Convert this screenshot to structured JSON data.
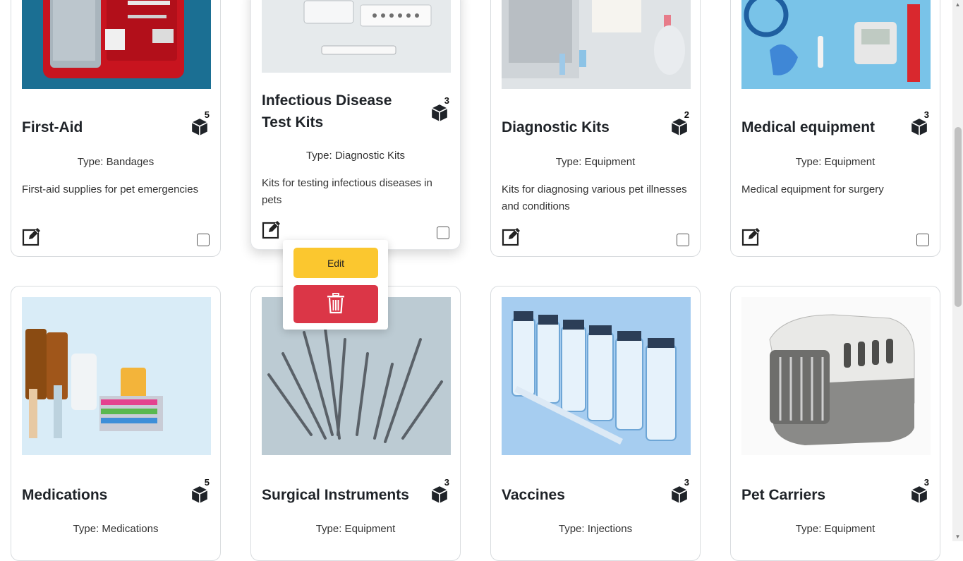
{
  "colors": {
    "edit_button": "#fbc72f",
    "delete_button": "#db3647"
  },
  "cards": [
    {
      "title": "First-Aid",
      "quantity": "5",
      "type": "Type: Bandages",
      "description": "First-aid supplies for pet emergencies",
      "image": "first-aid-kit-image"
    },
    {
      "title": "Infectious Disease Test Kits",
      "quantity": "3",
      "type": "Type: Diagnostic Kits",
      "description": "Kits for testing infectious diseases in pets",
      "image": "test-kit-image"
    },
    {
      "title": "Diagnostic Kits",
      "quantity": "2",
      "type": "Type: Equipment",
      "description": "Kits for diagnosing various pet illnesses and conditions",
      "image": "diagnostic-kit-image"
    },
    {
      "title": "Medical equipment",
      "quantity": "3",
      "type": "Type: Equipment",
      "description": "Medical equipment for surgery",
      "image": "medical-equipment-image"
    },
    {
      "title": "Medications",
      "quantity": "5",
      "type": "Type: Medications",
      "description": "",
      "image": "medications-image"
    },
    {
      "title": "Surgical Instruments",
      "quantity": "3",
      "type": "Type: Equipment",
      "description": "",
      "image": "surgical-instruments-image"
    },
    {
      "title": "Vaccines",
      "quantity": "3",
      "type": "Type: Injections",
      "description": "",
      "image": "vaccines-image"
    },
    {
      "title": "Pet Carriers",
      "quantity": "3",
      "type": "Type: Equipment",
      "description": "",
      "image": "pet-carrier-image"
    }
  ],
  "popup": {
    "edit_label": "Edit",
    "delete_icon": "trash-icon"
  }
}
